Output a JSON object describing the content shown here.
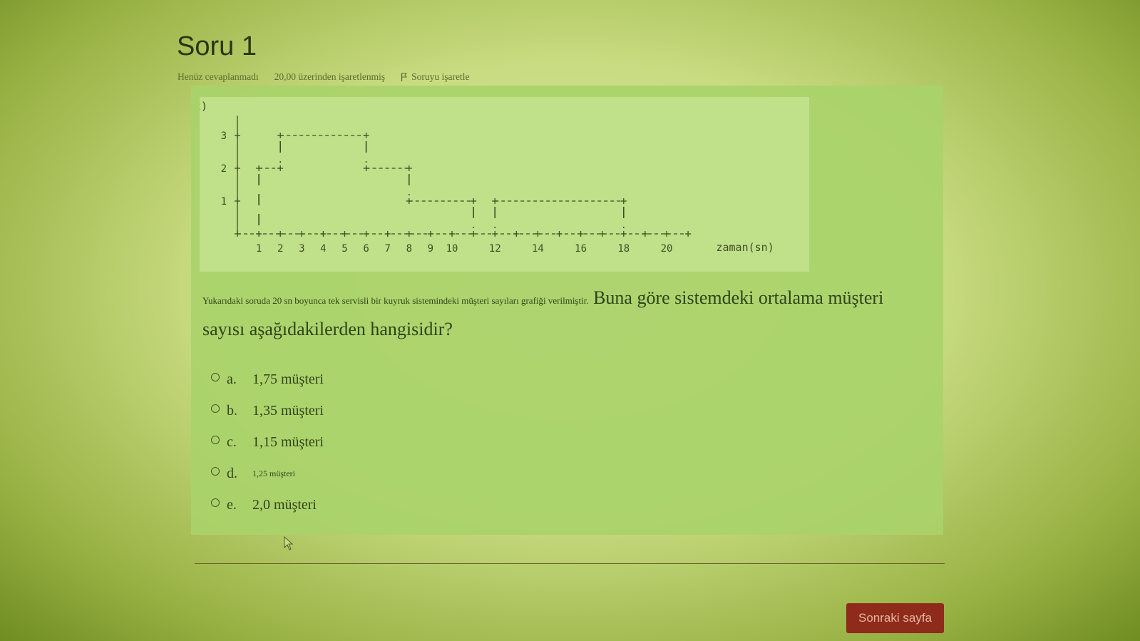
{
  "question": {
    "title": "Soru 1",
    "status": "Henüz cevaplanmadı",
    "points": "20,00 üzerinden işaretlenmiş",
    "flag_label": "Soruyu işaretle",
    "text_small": "Yukarıdaki soruda 20 sn boyunca tek servisli bir kuyruk sistemindeki müşteri sayıları grafiği verilmiştir.",
    "text_large": " Buna göre sistemdeki ortalama müşteri sayısı aşağıdakilerden hangisidir?"
  },
  "chart_data": {
    "type": "line",
    "step": true,
    "ylabel": "L(t)",
    "xlabel": "zaman(sn)",
    "y_ticks": [
      "1",
      "2",
      "3"
    ],
    "x_ticks": [
      "1",
      "2",
      "3",
      "4",
      "5",
      "6",
      "7",
      "8",
      "9",
      "10",
      "12",
      "14",
      "16",
      "18",
      "20"
    ],
    "x_tick_values": [
      1,
      2,
      3,
      4,
      5,
      6,
      7,
      8,
      9,
      10,
      12,
      14,
      16,
      18,
      20
    ],
    "xlim": [
      0,
      21
    ],
    "ylim": [
      0,
      3.6
    ],
    "segments": [
      {
        "x0": 1,
        "x1": 2,
        "y": 2
      },
      {
        "x0": 2,
        "x1": 6,
        "y": 3
      },
      {
        "x0": 6,
        "x1": 8,
        "y": 2
      },
      {
        "x0": 8,
        "x1": 11,
        "y": 1
      },
      {
        "x0": 12,
        "x1": 18,
        "y": 1
      }
    ],
    "vertical_lines": [
      {
        "x": 1,
        "y0": 0,
        "y1": 2
      },
      {
        "x": 2,
        "y0": 2,
        "y1": 3
      },
      {
        "x": 6,
        "y0": 2,
        "y1": 3
      },
      {
        "x": 8,
        "y0": 1,
        "y1": 2
      },
      {
        "x": 11,
        "y0": 0,
        "y1": 1
      },
      {
        "x": 12,
        "y0": 0,
        "y1": 1
      },
      {
        "x": 18,
        "y0": 0,
        "y1": 1
      }
    ]
  },
  "options": [
    {
      "letter": "a.",
      "text": "1,75 müşteri"
    },
    {
      "letter": "b.",
      "text": "1,35 müşteri"
    },
    {
      "letter": "c.",
      "text": "1,15 müşteri"
    },
    {
      "letter": "d.",
      "text": "1,25 müşteri"
    },
    {
      "letter": "e.",
      "text": "2,0 müşteri"
    }
  ],
  "next_button": "Sonraki sayfa"
}
